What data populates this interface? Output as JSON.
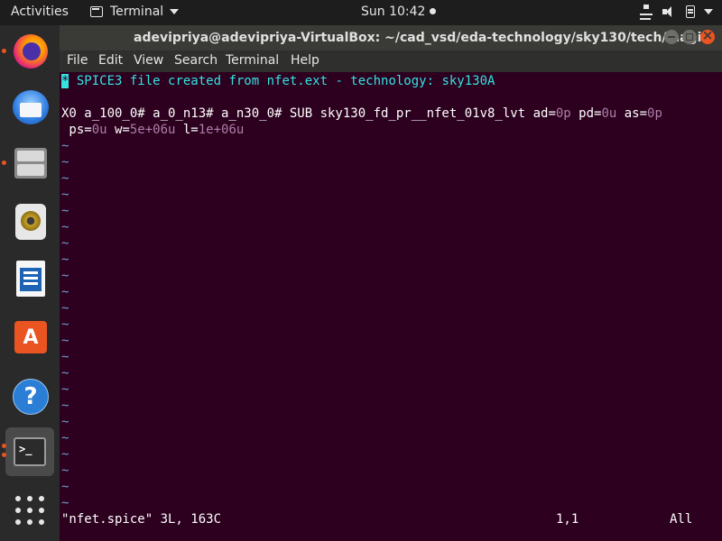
{
  "topbar": {
    "activities": "Activities",
    "app_name": "Terminal",
    "clock": "Sun 10:42"
  },
  "dock": {
    "apps": [
      "firefox",
      "thunderbird",
      "files",
      "rhythmbox",
      "libreoffice-writer",
      "ubuntu-software",
      "help",
      "terminal",
      "show-applications"
    ],
    "terminal_prompt": ">_"
  },
  "window": {
    "title": "adevipriya@adevipriya-VirtualBox: ~/cad_vsd/eda-technology/sky130/tech/magic",
    "menu": [
      "File",
      "Edit",
      "View",
      "Search",
      "Terminal",
      "Help"
    ]
  },
  "editor": {
    "cursor_char": "*",
    "header_comment": " SPICE3 file created from nfet.ext - technology: sky130A",
    "line2_prefix": "X0 a_100_0# a_0_n13# a_n30_0# SUB sky130_fd_pr__nfet_01v8_lvt ad=",
    "ad_val": "0p",
    "pd_label": " pd=",
    "pd_val": "0u",
    "as_label": " as=",
    "as_val": "0p",
    "ps_label": " ps=",
    "ps_val": "0u",
    "w_label": " w=",
    "w_val": "5e+06u",
    "l_label": " l=",
    "l_val": "1e+06u",
    "tilde": "~",
    "status_file": "\"nfet.spice\" 3L, 163C",
    "status_pos": "1,1",
    "status_scroll": "All"
  },
  "colors": {
    "terminal_bg": "#2c001e",
    "comment": "#34e2e2",
    "number": "#ad7fa8",
    "tilde": "#729fcf",
    "accent": "#e95420"
  }
}
